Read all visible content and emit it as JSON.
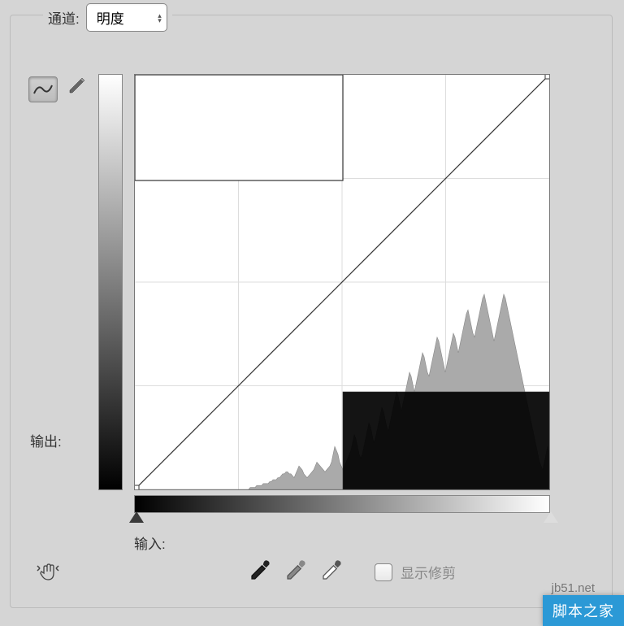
{
  "channel": {
    "label": "通道:",
    "value": "明度"
  },
  "output_label": "输出:",
  "input_label": "输入:",
  "show_clipping_label": "显示修剪",
  "watermark": {
    "url": "jb51.net",
    "text": "脚本之家"
  },
  "chart_data": {
    "type": "line",
    "title": "",
    "xlabel": "输入",
    "ylabel": "输出",
    "xlim": [
      0,
      255
    ],
    "ylim": [
      0,
      255
    ],
    "grid": true,
    "curve_points": [
      {
        "x": 0,
        "y": 0
      },
      {
        "x": 255,
        "y": 255
      }
    ],
    "overlay_box": {
      "x0": 0,
      "y0": 190,
      "x1": 128,
      "y1": 255
    },
    "selection_box": {
      "x0": 128,
      "y0": 0,
      "x1": 255,
      "y1": 60
    },
    "histogram": [
      0,
      0,
      0,
      0,
      0,
      0,
      0,
      0,
      0,
      0,
      0,
      0,
      0,
      0,
      0,
      0,
      0,
      0,
      0,
      0,
      0,
      0,
      0,
      0,
      0,
      0,
      0,
      0,
      0,
      0,
      0,
      0,
      0,
      0,
      0,
      0,
      0,
      0,
      0,
      0,
      0,
      0,
      0,
      0,
      0,
      0,
      0,
      0,
      0,
      0,
      0,
      0,
      0,
      0,
      0,
      0,
      0,
      0,
      0,
      0,
      0,
      0,
      0,
      0,
      0,
      0,
      0,
      0,
      0,
      0,
      0,
      1,
      1,
      1,
      1,
      2,
      2,
      2,
      2,
      3,
      3,
      3,
      3,
      4,
      4,
      5,
      5,
      5,
      6,
      6,
      7,
      8,
      8,
      9,
      9,
      8,
      8,
      7,
      6,
      8,
      10,
      12,
      11,
      10,
      8,
      7,
      6,
      7,
      8,
      9,
      10,
      12,
      14,
      13,
      12,
      11,
      10,
      9,
      10,
      11,
      12,
      14,
      18,
      22,
      20,
      18,
      14,
      12,
      10,
      12,
      14,
      16,
      18,
      20,
      24,
      28,
      26,
      22,
      18,
      16,
      18,
      22,
      26,
      30,
      34,
      32,
      28,
      24,
      26,
      30,
      34,
      38,
      42,
      40,
      36,
      32,
      30,
      34,
      38,
      42,
      46,
      50,
      48,
      44,
      40,
      44,
      48,
      52,
      56,
      60,
      58,
      54,
      50,
      54,
      58,
      62,
      66,
      70,
      68,
      64,
      60,
      58,
      62,
      66,
      70,
      74,
      78,
      76,
      72,
      68,
      64,
      60,
      64,
      68,
      72,
      76,
      80,
      78,
      74,
      70,
      74,
      78,
      82,
      86,
      90,
      92,
      88,
      84,
      80,
      78,
      82,
      86,
      90,
      94,
      98,
      100,
      96,
      92,
      88,
      84,
      80,
      76,
      80,
      84,
      88,
      92,
      96,
      100,
      98,
      94,
      90,
      86,
      82,
      78,
      74,
      70,
      66,
      62,
      58,
      54,
      50,
      46,
      42,
      38,
      34,
      30,
      26,
      22,
      18,
      14,
      12,
      10,
      14,
      18,
      22,
      18,
      14,
      10,
      6,
      4,
      2,
      2,
      1,
      1,
      0,
      0,
      0,
      0,
      0,
      0,
      0,
      0,
      0,
      0,
      0
    ]
  }
}
